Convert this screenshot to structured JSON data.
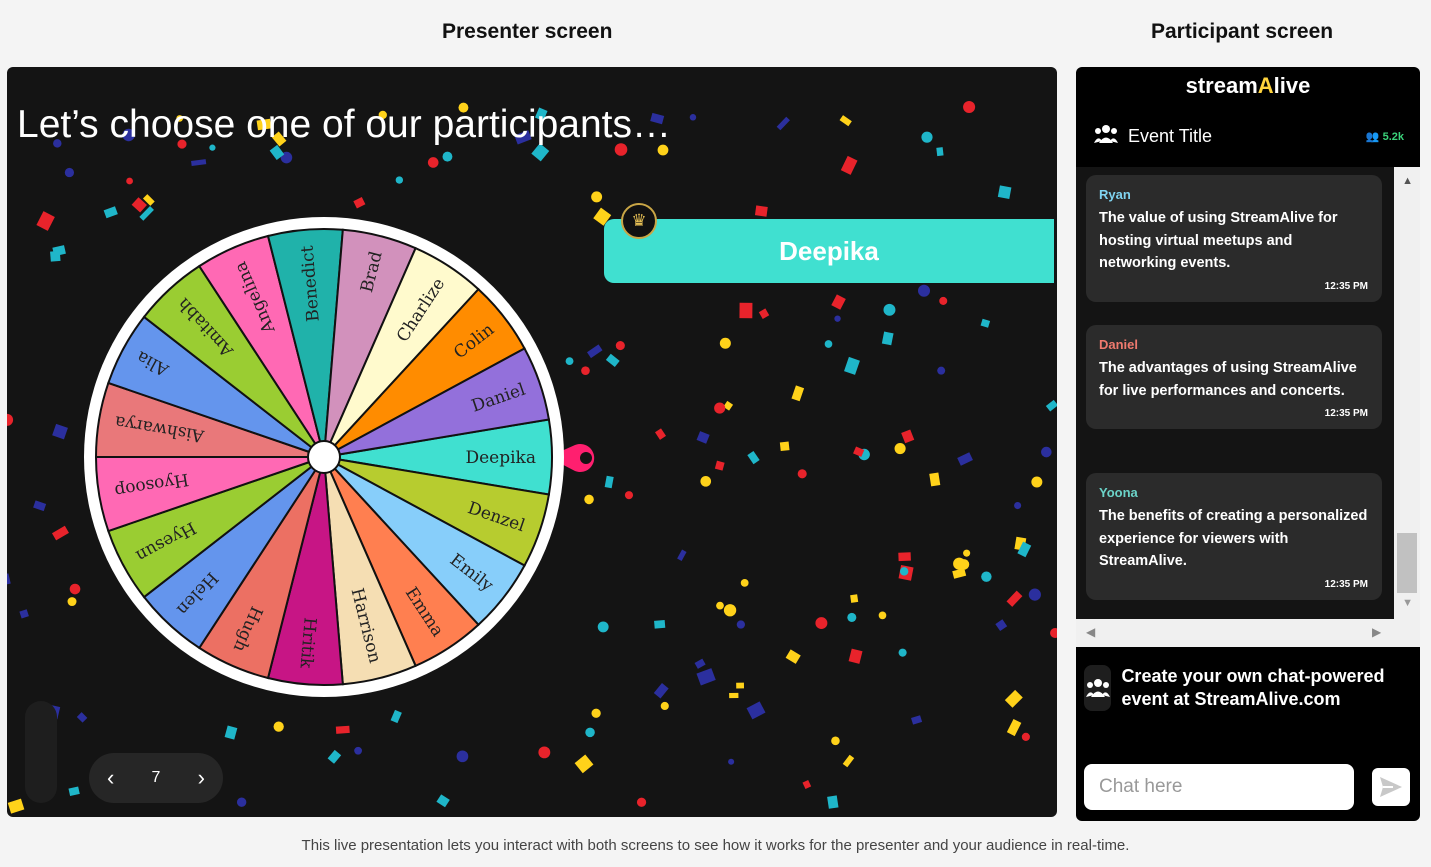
{
  "presenter": {
    "section_title": "Presenter screen",
    "headline": "Let’s choose one of our participants…",
    "winner": "Deepika",
    "page_number": "7",
    "wheel": {
      "names": [
        "Deepika",
        "Denzel",
        "Emily",
        "Emma",
        "Harrison",
        "Hritik",
        "Hugh",
        "Helen",
        "Hyesun",
        "Hyosoop",
        "Aishwarya",
        "Alia",
        "Amitabh",
        "Angelina",
        "Benedict",
        "Brad",
        "Charlize",
        "Colin",
        "Daniel"
      ],
      "colors": [
        "#40e0d0",
        "#b7cc2f",
        "#87cefa",
        "#ff7f50",
        "#f5deb3",
        "#c71585",
        "#ec7063",
        "#6495ed",
        "#9acd32",
        "#ff69b4",
        "#e9787a",
        "#6495ed",
        "#9acd32",
        "#ff69b4",
        "#20b2aa",
        "#d291bc",
        "#fffacd",
        "#ff8c00",
        "#9370db"
      ]
    }
  },
  "participant": {
    "section_title": "Participant screen",
    "brand_prefix": "stream",
    "brand_accent": "A",
    "brand_suffix": "live",
    "event_title": "Event Title",
    "viewer_count": "5.2k",
    "messages": [
      {
        "user": "Ryan",
        "color": "#7fd3f0",
        "text": "The value of using StreamAlive for hosting virtual meetups and networking events.",
        "time": "12:35 PM"
      },
      {
        "user": "Daniel",
        "color": "#f07a6e",
        "text": "The advantages of using StreamAlive for live performances and concerts.",
        "time": "12:35 PM"
      },
      {
        "user": "Yoona",
        "color": "#6bd3c8",
        "text": "The benefits of creating a personalized experience for viewers with StreamAlive.",
        "time": "12:35 PM"
      }
    ],
    "promo_text": "Create your own chat-powered event at StreamAlive.com",
    "chat_placeholder": "Chat here"
  },
  "footer": "This live presentation lets you interact with both screens to see how it works for the presenter and your audience in real-time.",
  "confetti_colors": [
    "#ffd21a",
    "#e8232b",
    "#1fb6c9",
    "#2b2f9e"
  ]
}
